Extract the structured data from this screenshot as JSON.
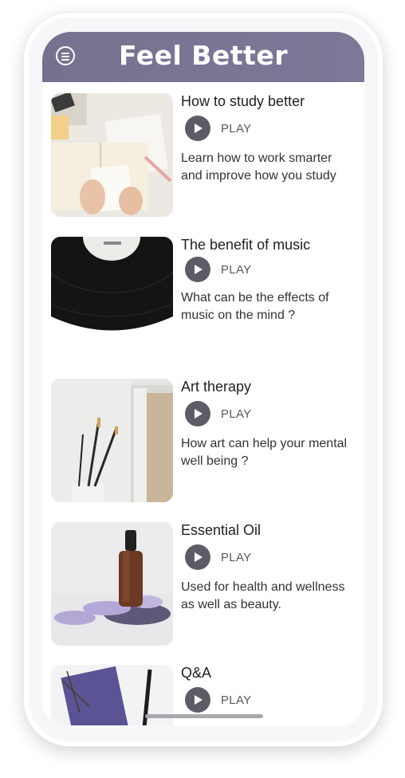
{
  "app": {
    "title": "Feel Better"
  },
  "header": {
    "menu_icon": "menu-icon"
  },
  "items": [
    {
      "title": "How to study better",
      "play_label": "PLAY",
      "description": "Learn how to work smarter and improve how you study",
      "image": "study-notebook-image"
    },
    {
      "title": "The benefit of music",
      "play_label": "PLAY",
      "description": "What can be the effects of music on the mind ?",
      "image": "vinyl-record-image"
    },
    {
      "title": "Art therapy",
      "play_label": "PLAY",
      "description": "How art can help your mental well being ?",
      "image": "paint-brushes-image"
    },
    {
      "title": "Essential Oil",
      "play_label": "PLAY",
      "description": "Used for health and wellness as well as beauty.",
      "image": "essential-oil-image"
    },
    {
      "title": "Q&A",
      "play_label": "PLAY",
      "description": "",
      "image": "notebook-pen-image"
    }
  ],
  "colors": {
    "header": "#77718f",
    "play_button": "#5f5b66"
  }
}
